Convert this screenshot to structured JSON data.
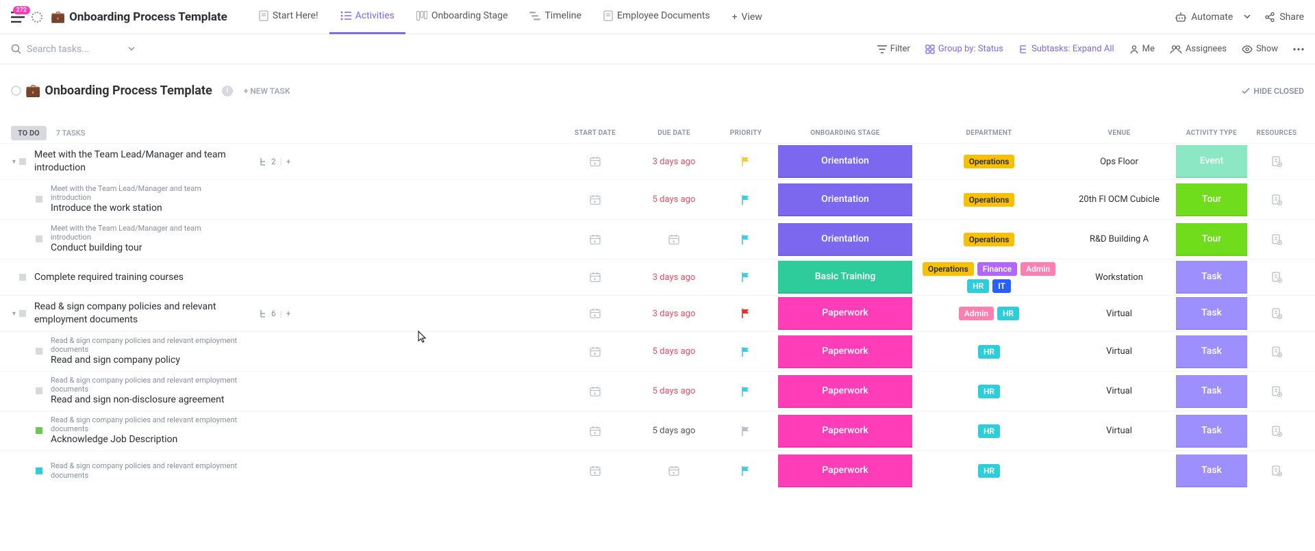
{
  "header": {
    "badge_count": "272",
    "title": "Onboarding Process Template",
    "tabs": [
      {
        "label": "Start Here!"
      },
      {
        "label": "Activities"
      },
      {
        "label": "Onboarding Stage"
      },
      {
        "label": "Timeline"
      },
      {
        "label": "Employee Documents"
      }
    ],
    "add_view": "View",
    "automate": "Automate",
    "share": "Share"
  },
  "toolbar": {
    "search_placeholder": "Search tasks...",
    "filter": "Filter",
    "group_by": "Group by: Status",
    "subtasks": "Subtasks: Expand All",
    "me": "Me",
    "assignees": "Assignees",
    "show": "Show"
  },
  "list_header": {
    "title": "Onboarding Process Template",
    "new_task": "+ NEW TASK",
    "hide_closed": "HIDE CLOSED"
  },
  "group": {
    "status": "TO DO",
    "count": "7 TASKS"
  },
  "columns": {
    "start": "START DATE",
    "due": "DUE DATE",
    "priority": "PRIORITY",
    "stage": "ONBOARDING STAGE",
    "dept": "DEPARTMENT",
    "venue": "VENUE",
    "type": "ACTIVITY TYPE",
    "resources": "RESOURCES"
  },
  "stages": {
    "orientation": "Orientation",
    "training": "Basic Training",
    "paperwork": "Paperwork"
  },
  "types": {
    "event": "Event",
    "tour": "Tour",
    "task": "Task"
  },
  "depts": {
    "operations": "Operations",
    "finance": "Finance",
    "admin": "Admin",
    "hr": "HR",
    "it": "IT"
  },
  "tasks": [
    {
      "name": "Meet with the Team Lead/Manager and team introduction",
      "subcount": "2",
      "due": "3 days ago",
      "due_red": true,
      "flag": "yellow",
      "stage": "orientation",
      "depts": [
        "operations"
      ],
      "venue": "Ops Floor",
      "type": "event",
      "children_parent_label": "Meet with the Team Lead/Manager and team introduction",
      "subs": [
        {
          "name": "Introduce the work station",
          "due": "5 days ago",
          "due_red": true,
          "flag": "cyan",
          "stage": "orientation",
          "depts": [
            "operations"
          ],
          "venue": "20th Fl OCM Cubicle",
          "type": "tour"
        },
        {
          "name": "Conduct building tour",
          "due": "",
          "due_red": false,
          "flag": "cyan",
          "stage": "orientation",
          "depts": [
            "operations"
          ],
          "venue": "R&D Building A",
          "type": "tour"
        }
      ]
    },
    {
      "name": "Complete required training courses",
      "due": "3 days ago",
      "due_red": true,
      "flag": "cyan",
      "stage": "training",
      "depts": [
        "operations",
        "finance",
        "admin",
        "hr",
        "it"
      ],
      "venue": "Workstation",
      "type": "task"
    },
    {
      "name": "Read & sign company policies and relevant employment documents",
      "subcount": "6",
      "due": "3 days ago",
      "due_red": true,
      "flag": "red",
      "stage": "paperwork",
      "depts": [
        "admin",
        "hr"
      ],
      "venue": "Virtual",
      "type": "task",
      "children_parent_label": "Read & sign company policies and relevant employment documents",
      "subs": [
        {
          "name": "Read and sign company policy",
          "due": "5 days ago",
          "due_red": true,
          "flag": "cyan",
          "stage": "paperwork",
          "depts": [
            "hr"
          ],
          "venue": "Virtual",
          "type": "task"
        },
        {
          "name": "Read and sign non-disclosure agreement",
          "due": "5 days ago",
          "due_red": true,
          "flag": "cyan",
          "stage": "paperwork",
          "depts": [
            "hr"
          ],
          "venue": "Virtual",
          "type": "task"
        },
        {
          "name": "Acknowledge Job Description",
          "status": "green",
          "due": "5 days ago",
          "due_red": false,
          "flag": "grey",
          "stage": "paperwork",
          "depts": [
            "hr"
          ],
          "venue": "Virtual",
          "type": "task"
        },
        {
          "name": "",
          "status": "cyan",
          "partial": true,
          "due": "",
          "due_red": true,
          "flag": "cyan",
          "stage": "paperwork",
          "depts": [
            "hr"
          ],
          "venue": "",
          "type": "task"
        }
      ]
    }
  ]
}
